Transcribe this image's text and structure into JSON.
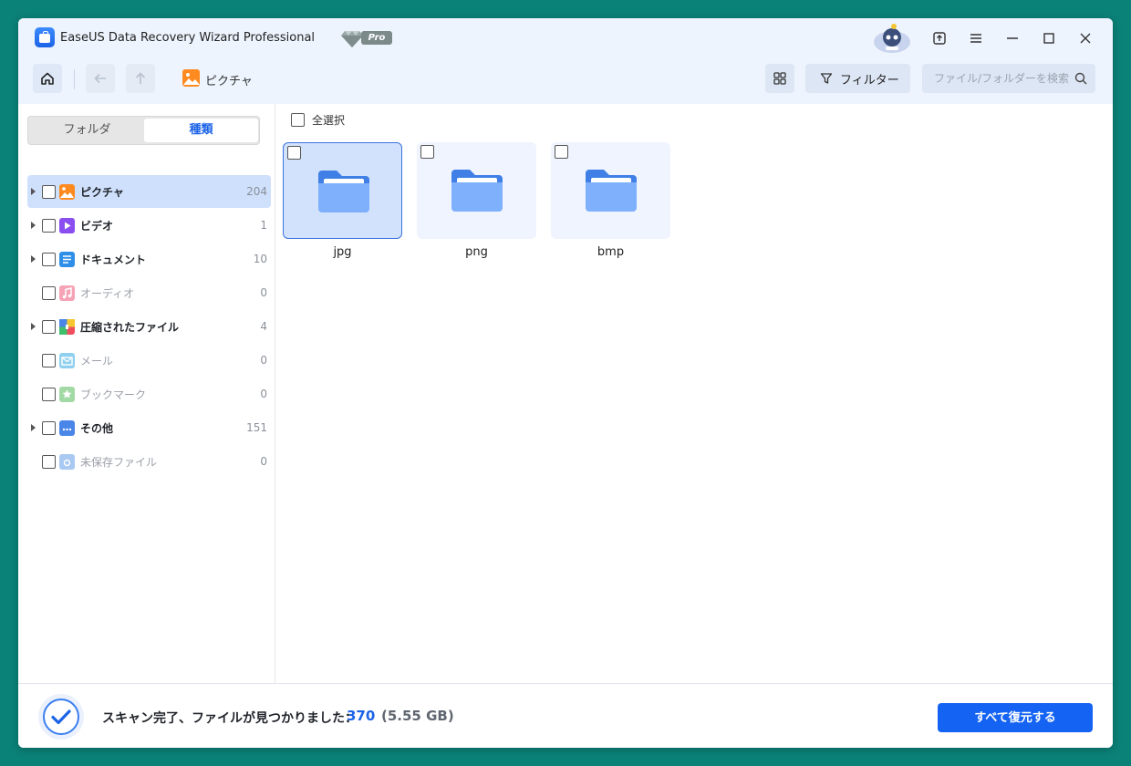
{
  "window": {
    "title": "EaseUS Data Recovery Wizard Professional",
    "badge": "Pro"
  },
  "toolbar": {
    "breadcrumb": "ピクチャ",
    "filter_label": "フィルター",
    "search_placeholder": "ファイル/フォルダーを検索"
  },
  "sidebar": {
    "tabs": [
      {
        "label": "フォルダ"
      },
      {
        "label": "種類"
      }
    ],
    "categories": [
      {
        "label": "ピクチャ",
        "count": "204",
        "icon": "picture-icon",
        "color": "#ff8a1f"
      },
      {
        "label": "ビデオ",
        "count": "1",
        "icon": "video-icon",
        "color": "#8a4df0"
      },
      {
        "label": "ドキュメント",
        "count": "10",
        "icon": "document-icon",
        "color": "#2f8fe8"
      },
      {
        "label": "オーディオ",
        "count": "0",
        "icon": "audio-icon",
        "color": "#f5a3b5"
      },
      {
        "label": "圧縮されたファイル",
        "count": "4",
        "icon": "archive-icon",
        "color": "#f04e5e"
      },
      {
        "label": "メール",
        "count": "0",
        "icon": "mail-icon",
        "color": "#8fd0ef"
      },
      {
        "label": "ブックマーク",
        "count": "0",
        "icon": "bookmark-icon",
        "color": "#a3d9a5"
      },
      {
        "label": "その他",
        "count": "151",
        "icon": "other-folder-icon",
        "color": "#4a86e8"
      },
      {
        "label": "未保存ファイル",
        "count": "0",
        "icon": "unsaved-file-icon",
        "color": "#a9c8f2"
      }
    ]
  },
  "content": {
    "select_all_label": "全選択",
    "folders": [
      {
        "name": "jpg"
      },
      {
        "name": "png"
      },
      {
        "name": "bmp"
      }
    ]
  },
  "status": {
    "message": "スキャン完了、ファイルが見つかりました：",
    "count": "370",
    "size": "(5.55 GB)",
    "recover_all_label": "すべて復元する"
  },
  "colors": {
    "accent": "#1463f3",
    "selected_bg": "#cfe0fc",
    "panel_bg": "#eef4fe"
  }
}
